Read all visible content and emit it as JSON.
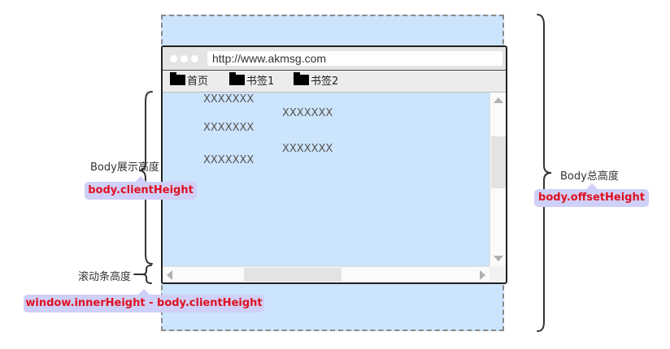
{
  "browser": {
    "url": "http://www.akmsg.com",
    "bookmarks": [
      "首页",
      "书签1",
      "书签2"
    ],
    "content_lines": [
      "XXXXXXX",
      "XXXXXXX",
      "XXXXXXX",
      "XXXXXXX",
      "XXXXXXX"
    ]
  },
  "annotations": {
    "visible_height_label": "Body展示高度",
    "visible_height_prop": "body.clientHeight",
    "scrollbar_height_label": "滚动条高度",
    "scrollbar_height_prop": "window.innerHeight - body.clientHeight",
    "total_height_label": "Body总高度",
    "total_height_prop": "body.offsetHeight"
  },
  "colors": {
    "body_fill": "#cce4fc",
    "tag_fill": "#cfd0f7",
    "tag_text": "#e01020",
    "brace": "#333333"
  }
}
